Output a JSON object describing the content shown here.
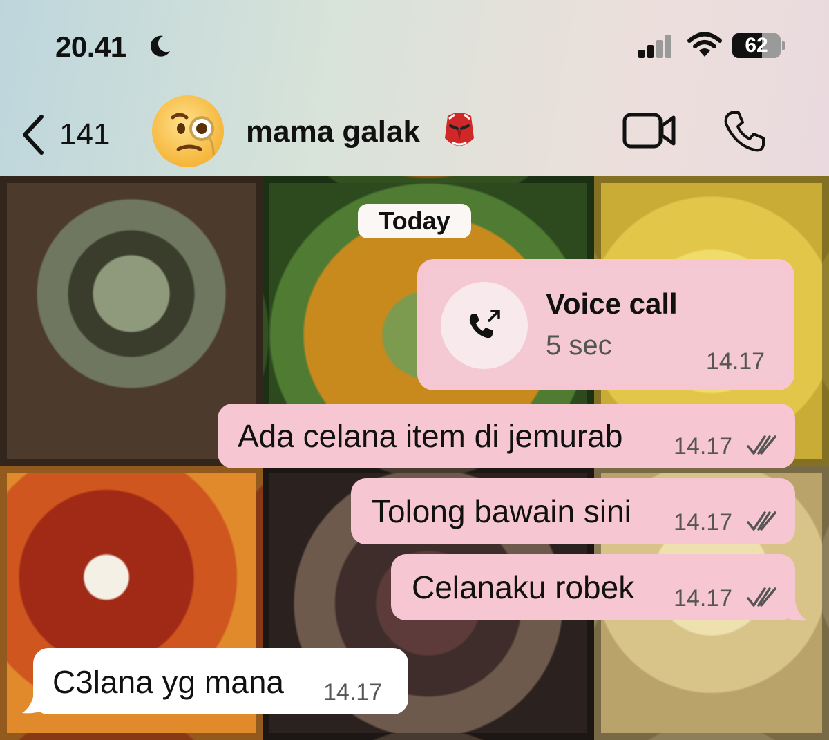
{
  "status_bar": {
    "time": "20.41",
    "battery": "62",
    "battery_fraction": 0.62,
    "icons": [
      "moon-icon",
      "signal-icon",
      "wifi-icon",
      "battery-icon"
    ]
  },
  "header": {
    "back_count": "141",
    "contact_name": "mama galak",
    "icons": [
      "chevron-left-icon",
      "avatar-emoji",
      "red-mask-emoji-icon",
      "video-call-icon",
      "phone-icon"
    ]
  },
  "chat": {
    "date_separator": "Today",
    "call": {
      "title": "Voice call",
      "duration": "5 sec",
      "time": "14.17",
      "icon": "outgoing-call-icon"
    },
    "messages": [
      {
        "direction": "out",
        "text": "Ada celana item di jemurab",
        "time": "14.17",
        "status": "read"
      },
      {
        "direction": "out",
        "text": "Tolong bawain sini",
        "time": "14.17",
        "status": "read"
      },
      {
        "direction": "out",
        "text": "Celanaku robek",
        "time": "14.17",
        "status": "read"
      },
      {
        "direction": "in",
        "text": "C3lana yg mana",
        "time": "14.17"
      }
    ]
  },
  "colors": {
    "outgoing_bubble": "#f7c6d3",
    "incoming_bubble": "#ffffff",
    "date_pill": "#fbf7f4"
  }
}
